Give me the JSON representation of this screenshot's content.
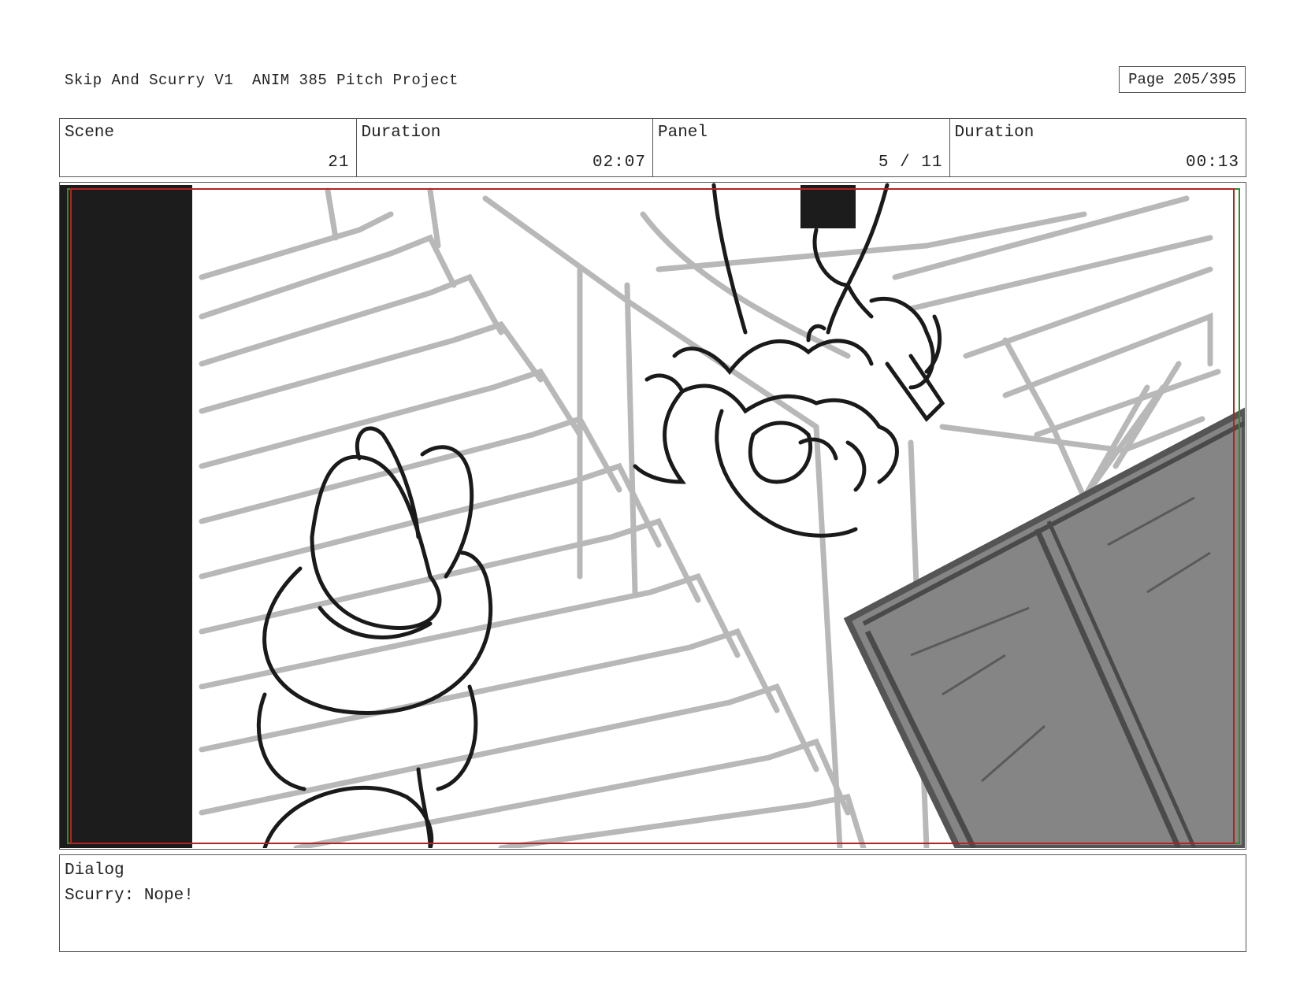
{
  "header": {
    "title": "Skip And Scurry V1  ANIM 385 Pitch Project",
    "page": "Page 205/395"
  },
  "info": {
    "scene_label": "Scene",
    "scene_value": "21",
    "scene_duration_label": "Duration",
    "scene_duration_value": "02:07",
    "panel_label": "Panel",
    "panel_value": "5 / 11",
    "panel_duration_label": "Duration",
    "panel_duration_value": "00:13"
  },
  "dialog": {
    "label": "Dialog",
    "text": "Scurry: Nope!"
  },
  "colors": {
    "safe_frame_red": "#b22222",
    "safe_frame_green": "#2e8b2e",
    "sketch_gray": "#b5b5b5",
    "sketch_ink": "#1a1a1a",
    "crate_fill": "#858585"
  }
}
